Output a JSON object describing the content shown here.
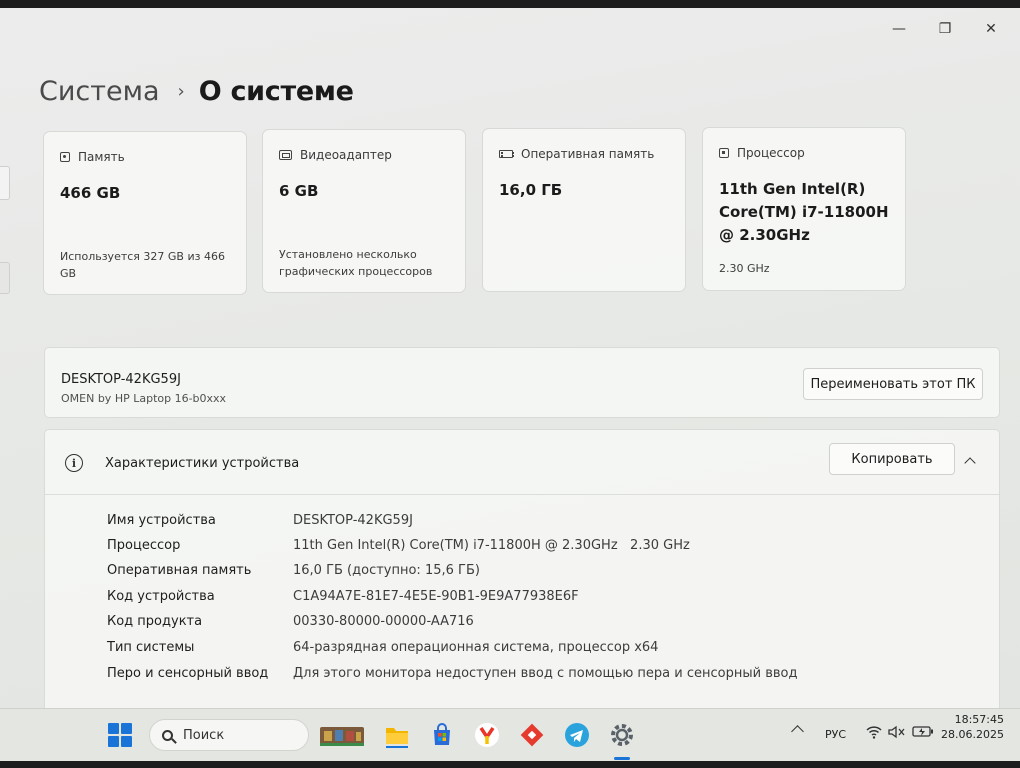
{
  "breadcrumb": {
    "parent": "Система",
    "separator": "›",
    "current": "О системе"
  },
  "window_controls": {
    "minimize": "—",
    "restore": "❐",
    "close": "✕"
  },
  "cards": {
    "storage": {
      "title": "Память",
      "value": "466 GB",
      "sub": "Используется 327 GB из 466 GB"
    },
    "gpu": {
      "title": "Видеоадаптер",
      "value": "6 GB",
      "sub": "Установлено несколько графических процессоров"
    },
    "ram": {
      "title": "Оперативная память",
      "value": "16,0 ГБ"
    },
    "cpu": {
      "title": "Процессор",
      "value": "11th Gen Intel(R) Core(TM) i7-11800H @ 2.30GHz",
      "sub": "2.30 GHz"
    }
  },
  "device": {
    "name": "DESKTOP-42KG59J",
    "model": "OMEN by HP Laptop 16-b0xxx",
    "rename_button": "Переименовать этот ПК"
  },
  "specs": {
    "title": "Характеристики устройства",
    "copy_button": "Копировать",
    "rows": [
      {
        "label": "Имя устройства",
        "value": "DESKTOP-42KG59J"
      },
      {
        "label": "Процессор",
        "value": "11th Gen Intel(R) Core(TM) i7-11800H @ 2.30GHz   2.30 GHz"
      },
      {
        "label": "Оперативная память",
        "value": "16,0 ГБ (доступно: 15,6 ГБ)"
      },
      {
        "label": "Код устройства",
        "value": "C1A94A7E-81E7-4E5E-90B1-9E9A77938E6F"
      },
      {
        "label": "Код продукта",
        "value": "00330-80000-00000-AA716"
      },
      {
        "label": "Тип системы",
        "value": "64-разрядная операционная система, процессор x64"
      },
      {
        "label": "Перо и сенсорный ввод",
        "value": "Для этого монитора недоступен ввод с помощью пера и сенсорный ввод"
      }
    ]
  },
  "taskbar": {
    "search_label": "Поиск",
    "language": "РУС",
    "time": "18:57:45",
    "date": "28.06.2025"
  }
}
